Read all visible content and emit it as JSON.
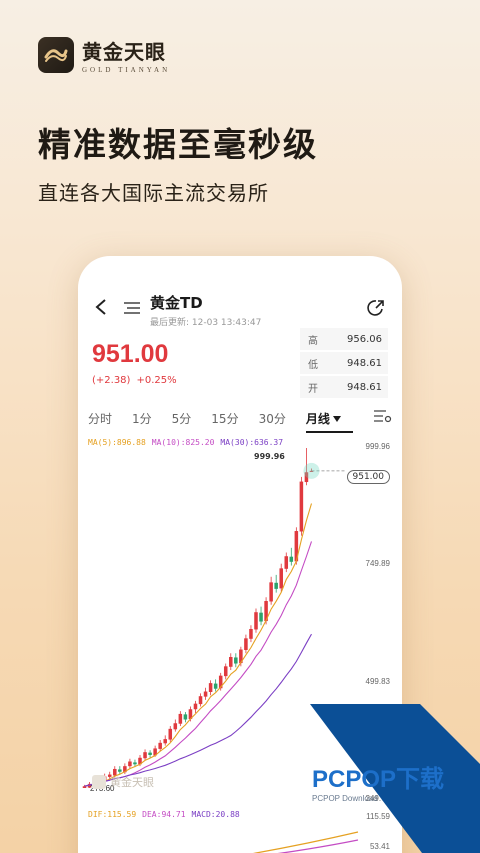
{
  "brand": {
    "name_cn": "黄金天眼",
    "name_en": "GOLD TIANYAN"
  },
  "headline": "精准数据至毫秒级",
  "subline": "直连各大国际主流交易所",
  "colors": {
    "up": "#e0393e",
    "ma5": "#e5a122",
    "ma10": "#c44cc4",
    "ma30": "#7b3fc4",
    "accent": "#1a1a1a"
  },
  "nav": {
    "back_icon": "back-arrow-icon",
    "menu_icon": "menu-icon",
    "title": "黄金TD",
    "updated": "最后更新: 12-03 13:43:47",
    "share_icon": "share-icon"
  },
  "quote": {
    "price": "951.00",
    "change_abs": "(+2.38)",
    "change_pct": "+0.25%",
    "stats": [
      {
        "k": "高",
        "v": "956.06"
      },
      {
        "k": "低",
        "v": "948.61"
      },
      {
        "k": "开",
        "v": "948.61"
      }
    ]
  },
  "tabs": [
    {
      "label": "分时"
    },
    {
      "label": "1分"
    },
    {
      "label": "5分"
    },
    {
      "label": "15分"
    },
    {
      "label": "30分"
    },
    {
      "label": "月线",
      "active": true
    }
  ],
  "ma": {
    "ma5": "MA(5):896.88",
    "ma10": "MA(10):825.20",
    "ma30": "MA(30):636.37"
  },
  "axis": {
    "top": "999.96",
    "mid": "749.89",
    "low": "499.83",
    "bottom": "249.77"
  },
  "chart_labels": {
    "high": "999.96",
    "current": "951.00",
    "min": "273.60"
  },
  "macd": {
    "dif": "DIF:115.59",
    "dea": "DEA:94.71",
    "macd": "MACD:20.88",
    "top": "115.59",
    "bottom": "53.41"
  },
  "watermark": "黄金天眼",
  "overlay": {
    "name": "PCPOP下载",
    "sub": "PCPOP Download"
  },
  "chart_data": {
    "type": "candlestick",
    "ylim": [
      249.77,
      999.96
    ],
    "candles": [
      [
        268,
        275,
        262,
        278
      ],
      [
        272,
        280,
        268,
        284
      ],
      [
        279,
        286,
        274,
        290
      ],
      [
        285,
        290,
        280,
        298
      ],
      [
        288,
        296,
        284,
        302
      ],
      [
        295,
        300,
        290,
        306
      ],
      [
        298,
        312,
        294,
        318
      ],
      [
        311,
        306,
        300,
        318
      ],
      [
        305,
        318,
        301,
        324
      ],
      [
        318,
        328,
        312,
        334
      ],
      [
        326,
        322,
        316,
        332
      ],
      [
        322,
        336,
        318,
        342
      ],
      [
        335,
        348,
        330,
        354
      ],
      [
        347,
        342,
        336,
        352
      ],
      [
        341,
        356,
        338,
        362
      ],
      [
        355,
        368,
        350,
        374
      ],
      [
        367,
        376,
        362,
        384
      ],
      [
        375,
        398,
        370,
        404
      ],
      [
        397,
        410,
        392,
        418
      ],
      [
        409,
        430,
        404,
        436
      ],
      [
        429,
        418,
        412,
        434
      ],
      [
        419,
        440,
        414,
        446
      ],
      [
        440,
        452,
        432,
        458
      ],
      [
        451,
        468,
        446,
        474
      ],
      [
        467,
        478,
        460,
        486
      ],
      [
        477,
        496,
        470,
        502
      ],
      [
        495,
        484,
        478,
        504
      ],
      [
        485,
        512,
        480,
        518
      ],
      [
        511,
        532,
        504,
        538
      ],
      [
        531,
        552,
        524,
        560
      ],
      [
        551,
        538,
        530,
        560
      ],
      [
        539,
        568,
        532,
        574
      ],
      [
        567,
        592,
        560,
        600
      ],
      [
        591,
        612,
        584,
        620
      ],
      [
        611,
        648,
        604,
        656
      ],
      [
        647,
        628,
        620,
        660
      ],
      [
        629,
        672,
        622,
        680
      ],
      [
        671,
        712,
        664,
        724
      ],
      [
        711,
        698,
        690,
        728
      ],
      [
        699,
        742,
        692,
        752
      ],
      [
        741,
        768,
        734,
        776
      ],
      [
        767,
        756,
        748,
        786
      ],
      [
        757,
        822,
        750,
        830
      ],
      [
        821,
        928,
        812,
        938
      ],
      [
        927,
        948,
        920,
        999.96
      ],
      [
        948.61,
        951,
        948.61,
        956.06
      ]
    ]
  }
}
